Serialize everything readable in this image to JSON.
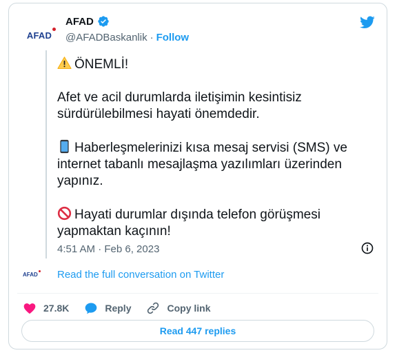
{
  "author": {
    "logo_text": "AFAD",
    "name": "AFAD",
    "handle": "@AFADBaskanlik",
    "separator": "·",
    "follow_label": "Follow"
  },
  "tweet": {
    "paragraphs": [
      {
        "emoji": "warning-icon",
        "text": "ÖNEMLİ!"
      },
      {
        "emoji": null,
        "text": "Afet ve acil durumlarda iletişimin kesintisiz sürdürülebilmesi hayati önemdedir."
      },
      {
        "emoji": "mobile-phone-icon",
        "text": "Haberleşmelerinizi kısa mesaj servisi (SMS) ve internet tabanlı mesajlaşma yazılımları üzerinden yapınız."
      },
      {
        "emoji": "prohibited-icon",
        "text": "Hayati durumlar dışında telefon görüşmesi yapmaktan kaçının!"
      }
    ],
    "timestamp": "4:51 AM · Feb 6, 2023"
  },
  "conversation": {
    "logo_text": "AFAD",
    "link_label": "Read the full conversation on Twitter"
  },
  "actions": {
    "like_count": "27.8K",
    "reply_label": "Reply",
    "copy_label": "Copy link"
  },
  "replies_button_label": "Read 447 replies",
  "colors": {
    "accent": "#1d9bf0",
    "like": "#f91880",
    "text": "#0f1419",
    "muted": "#536471",
    "border": "#cfd9de"
  }
}
